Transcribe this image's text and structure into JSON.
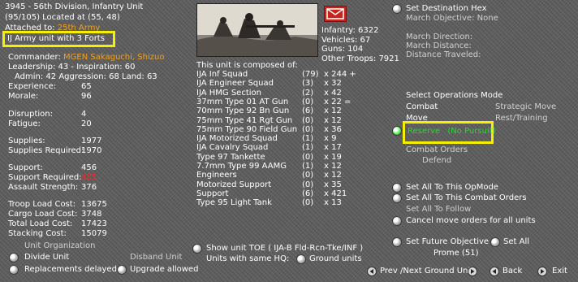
{
  "unit": {
    "title": "3945 - 56th Division, Infantry Unit",
    "strength_location": "(95/105) Located at (55, 48)",
    "attached_prefix": "Attached to:",
    "attached_value": "25th Army",
    "hq_note": "IJ Army unit with 3 Forts",
    "commander_prefix": "Commander:",
    "commander_name": "MGEN Sakaguchi, Shizuo",
    "leadership": "Leadership: 43 - Inspiration: 60",
    "admin": "Admin: 42  Aggression: 68 Land: 63"
  },
  "stats": [
    {
      "label": "Experience:",
      "value": "65"
    },
    {
      "label": "Morale:",
      "value": "96"
    },
    {
      "label": "Disruption:",
      "value": "4"
    },
    {
      "label": "Fatigue:",
      "value": "20"
    },
    {
      "label": "Supplies:",
      "value": "1977"
    },
    {
      "label": "Supplies Required:",
      "value": "1970"
    },
    {
      "label": "Support:",
      "value": "456"
    },
    {
      "label": "Support Required:",
      "value": "485"
    },
    {
      "label": "Assault Strength:",
      "value": "376"
    },
    {
      "label": "Troop Load Cost:",
      "value": "13675"
    },
    {
      "label": "Cargo Load Cost:",
      "value": "3748"
    },
    {
      "label": "Total Load Cost:",
      "value": "17423"
    },
    {
      "label": "Stacking Cost:",
      "value": "15079"
    }
  ],
  "totals": {
    "infantry": "Infantry: 6322",
    "vehicles": "Vehicles: 67",
    "guns": "Guns: 104",
    "other": "Other Troops: 7921"
  },
  "composition": {
    "heading": "This unit is composed of:",
    "rows": [
      {
        "name": "IJA Inf Squad",
        "n": "(79)",
        "x": "x 244 +"
      },
      {
        "name": "IJA Engineer Squad",
        "n": "(3)",
        "x": "x 32"
      },
      {
        "name": "IJA HMG Section",
        "n": "(2)",
        "x": "x 42"
      },
      {
        "name": "37mm Type 01 AT Gun",
        "n": "(0)",
        "x": "x 22 ="
      },
      {
        "name": "70mm Type 92 Bn Gun",
        "n": "(6)",
        "x": "x 12"
      },
      {
        "name": "75mm Type 41 Rgt Gun",
        "n": "(0)",
        "x": "x 12"
      },
      {
        "name": "75mm Type 90 Field Gun",
        "n": "(0)",
        "x": "x 36"
      },
      {
        "name": "IJA Motorized Squad",
        "n": "(1)",
        "x": "x 9"
      },
      {
        "name": "IJA Cavalry Squad",
        "n": "(1)",
        "x": "x 17"
      },
      {
        "name": "Type 97 Tankette",
        "n": "(0)",
        "x": "x 19"
      },
      {
        "name": "7.7mm Type 99 AAMG",
        "n": "(1)",
        "x": "x 12"
      },
      {
        "name": "Engineers",
        "n": "(0)",
        "x": "x 12"
      },
      {
        "name": "Motorized Support",
        "n": "(0)",
        "x": "x 35"
      },
      {
        "name": "Support",
        "n": "(6)",
        "x": "x 421"
      },
      {
        "name": "Type 95 Light Tank",
        "n": "(0)",
        "x": "x 13"
      }
    ]
  },
  "march": {
    "set_dest": "Set Destination Hex",
    "objective": "March Objective: None",
    "direction": "March Direction:",
    "distance": "March Distance:",
    "traveled": "Distance Traveled:"
  },
  "ops": {
    "heading": "Select Operations Mode",
    "combat": "Combat",
    "strategic": "Strategic Move",
    "move": "Move",
    "rest": "Rest/Training",
    "reserve": "Reserve",
    "no_pursuit": "(No Pursuit)",
    "combat_orders": "Combat Orders",
    "defend": "Defend",
    "set_all_opmode": "Set All To This OpMode",
    "set_all_combat": "Set All To This Combat Orders",
    "set_all_follow": "Set All To Follow",
    "cancel_move": "Cancel move orders for all units",
    "future_obj": "Set Future Objective",
    "set_all": "Set All",
    "prome": "Prome (51)"
  },
  "bottom": {
    "unit_org": "Unit Organization",
    "divide": "Divide Unit",
    "disband": "Disband Unit",
    "replacements": "Replacements delayed",
    "upgrade": "Upgrade allowed",
    "show_toe": "Show unit TOE ( IJA-B Fld-Rcn-Tke/INF )",
    "units_same_hq": "Units with same HQ:",
    "ground_units": "Ground units",
    "prev_next": "Prev /Next Ground Unit",
    "back": "Back",
    "exit": "Exit"
  },
  "colors": {
    "highlight": "#f6f000",
    "orange": "#f0a020",
    "red": "#e03030",
    "green": "#22dd22"
  },
  "icons": {
    "mail": "envelope-icon",
    "photo": "unit-photo"
  }
}
